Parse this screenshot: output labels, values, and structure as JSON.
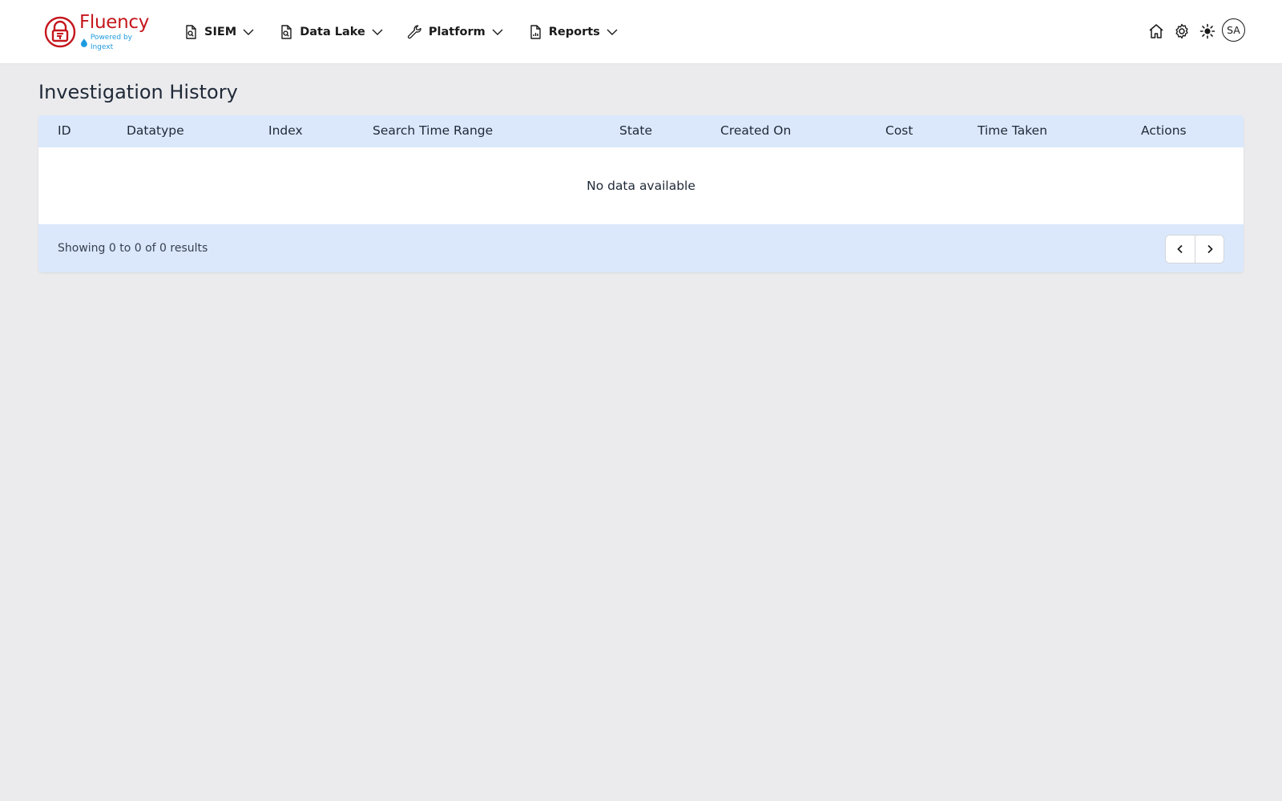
{
  "app": {
    "logo_name": "Fluency",
    "logo_subtitle": "Powered by Ingext",
    "brand_color": "#c4161c",
    "sub_color": "#1e9be0"
  },
  "nav": [
    {
      "label": "SIEM",
      "icon": "document-search-icon"
    },
    {
      "label": "Data Lake",
      "icon": "document-search-icon"
    },
    {
      "label": "Platform",
      "icon": "wrench-icon"
    },
    {
      "label": "Reports",
      "icon": "document-chart-icon"
    }
  ],
  "header_icons": [
    "home-icon",
    "gear-icon",
    "sun-icon"
  ],
  "user": {
    "initials": "SA"
  },
  "page": {
    "title": "Investigation History"
  },
  "table": {
    "columns": [
      "ID",
      "Datatype",
      "Index",
      "Search Time Range",
      "State",
      "Created On",
      "Cost",
      "Time Taken",
      "Actions"
    ],
    "empty_text": "No data available",
    "header_bg": "#dbe8fc"
  },
  "pagination": {
    "summary": "Showing 0 to 0 of 0 results",
    "prev_icon": "chevron-left-icon",
    "next_icon": "chevron-right-icon"
  }
}
